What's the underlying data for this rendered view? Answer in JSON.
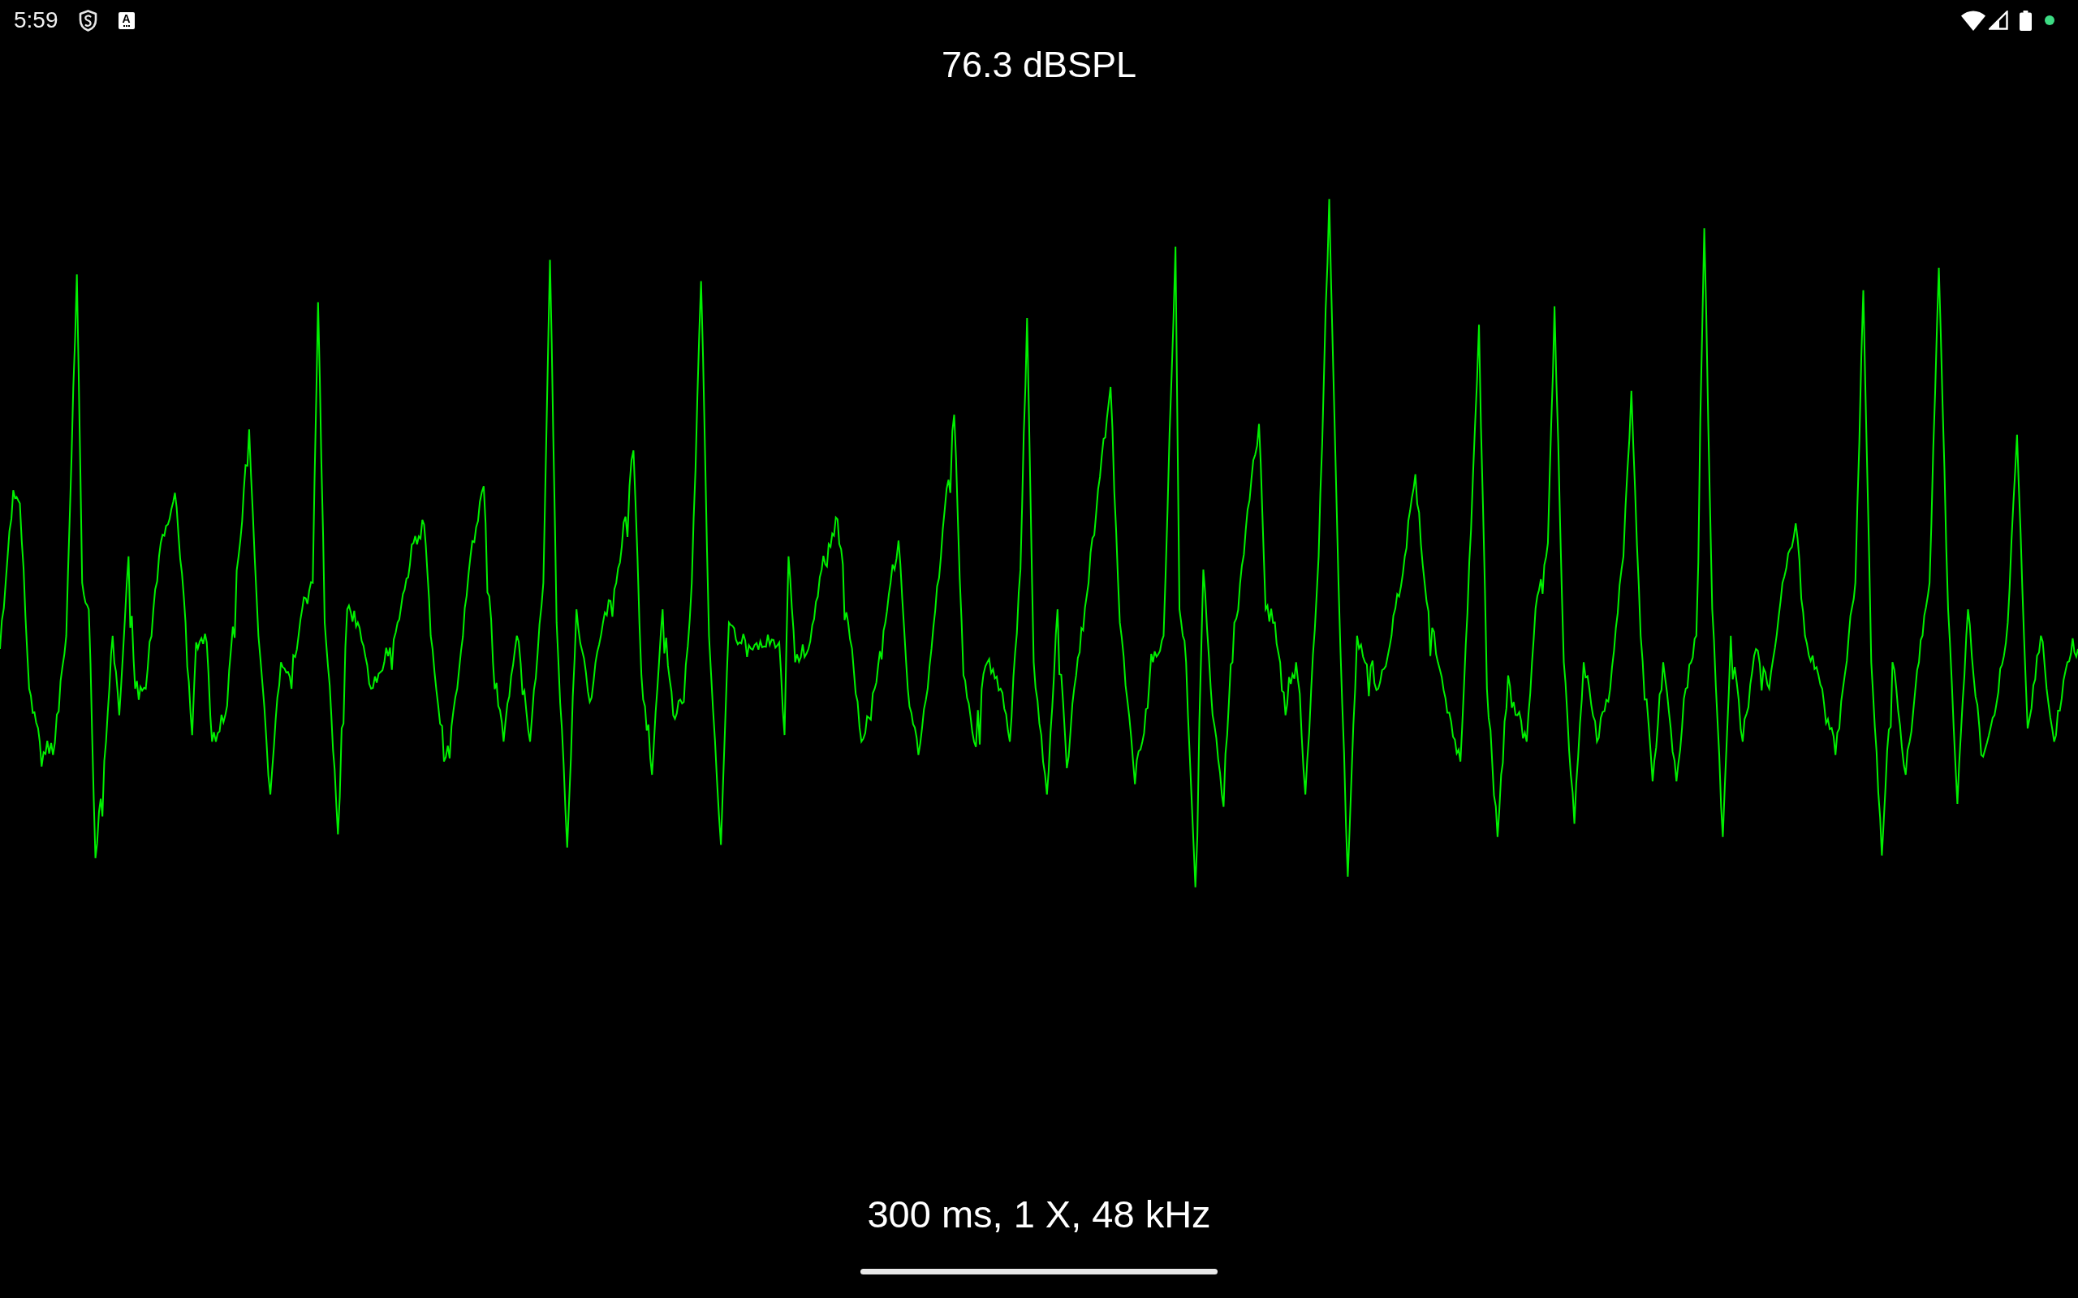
{
  "status_bar": {
    "time": "5:59",
    "notification_letter": "A"
  },
  "level_reading": "76.3 dBSPL",
  "settings_readout": "300 ms, 1 X, 48 kHz"
}
